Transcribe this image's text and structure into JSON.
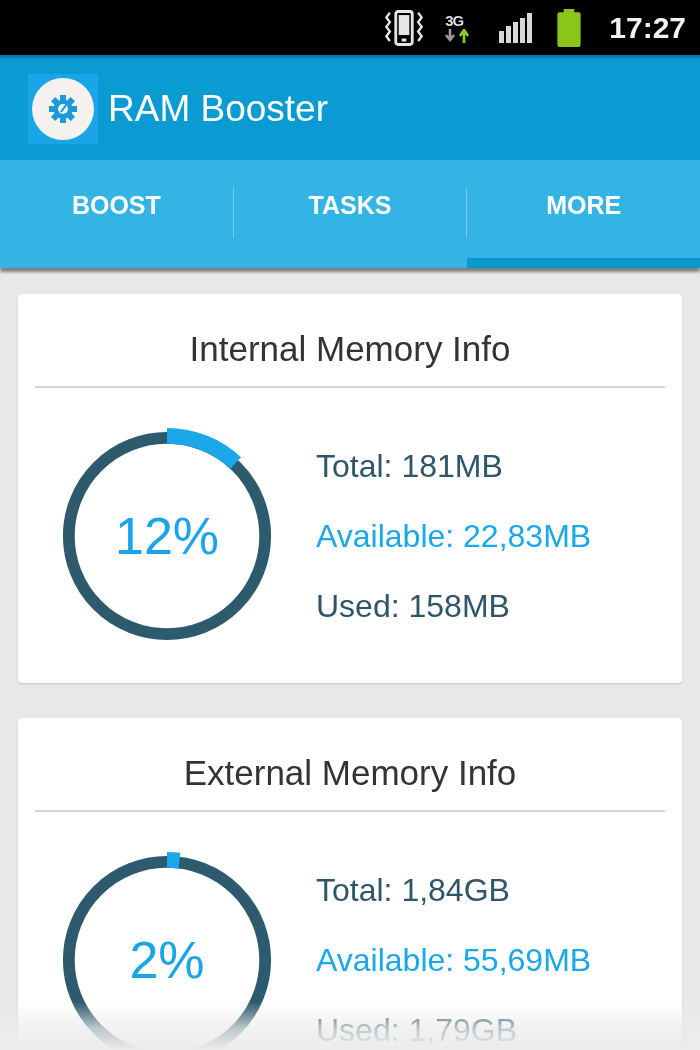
{
  "status_bar": {
    "network_type": "3G",
    "time": "17:27"
  },
  "app_bar": {
    "title": "RAM Booster"
  },
  "tabs": [
    {
      "label": "BOOST",
      "selected": false
    },
    {
      "label": "TASKS",
      "selected": false
    },
    {
      "label": "MORE",
      "selected": true
    }
  ],
  "cards": [
    {
      "title": "Internal Memory Info",
      "level": 0.12,
      "percent": "12%",
      "total": "Total: 181MB",
      "available": "Available: 22,83MB",
      "used": "Used: 158MB"
    },
    {
      "title": "External Memory Info",
      "level": 0.02,
      "percent": "2%",
      "total": "Total: 1,84GB",
      "available": "Available: 55,69MB",
      "used": "Used: 1,79GB"
    }
  ]
}
